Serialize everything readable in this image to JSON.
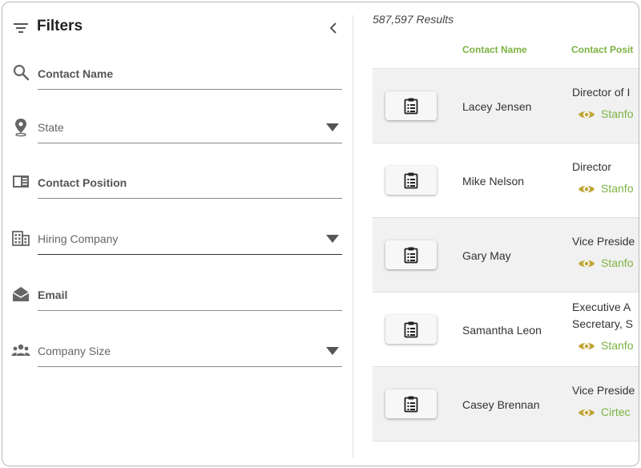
{
  "filters": {
    "title": "Filters",
    "fields": [
      {
        "label": "Contact Name",
        "icon": "search-icon",
        "kind": "text"
      },
      {
        "label": "State",
        "icon": "location-pin-icon",
        "kind": "select"
      },
      {
        "label": "Contact Position",
        "icon": "id-card-icon",
        "kind": "text"
      },
      {
        "label": "Hiring Company",
        "icon": "building-icon",
        "kind": "select"
      },
      {
        "label": "Email",
        "icon": "envelope-open-icon",
        "kind": "text"
      },
      {
        "label": "Company Size",
        "icon": "people-group-icon",
        "kind": "select"
      }
    ]
  },
  "results": {
    "count": "587,597 Results",
    "columns": {
      "name": "Contact Name",
      "position": "Contact Posit"
    },
    "rows": [
      {
        "name": "Lacey Jensen",
        "position_line1": "Director of I",
        "position_line2": "",
        "company": "Stanfo"
      },
      {
        "name": "Mike Nelson",
        "position_line1": "Director",
        "position_line2": "",
        "company": "Stanfo"
      },
      {
        "name": "Gary May",
        "position_line1": "Vice Preside",
        "position_line2": "",
        "company": "Stanfo"
      },
      {
        "name": "Samantha Leon",
        "position_line1": "Executive A",
        "position_line2": "Secretary, S",
        "company": "Stanfo"
      },
      {
        "name": "Casey Brennan",
        "position_line1": "Vice Preside",
        "position_line2": "",
        "company": "Cirtec"
      }
    ]
  },
  "colors": {
    "accent_green": "#7cb342",
    "eye_icon": "#c0a63a",
    "row_alt_bg": "#f1f1f1"
  }
}
